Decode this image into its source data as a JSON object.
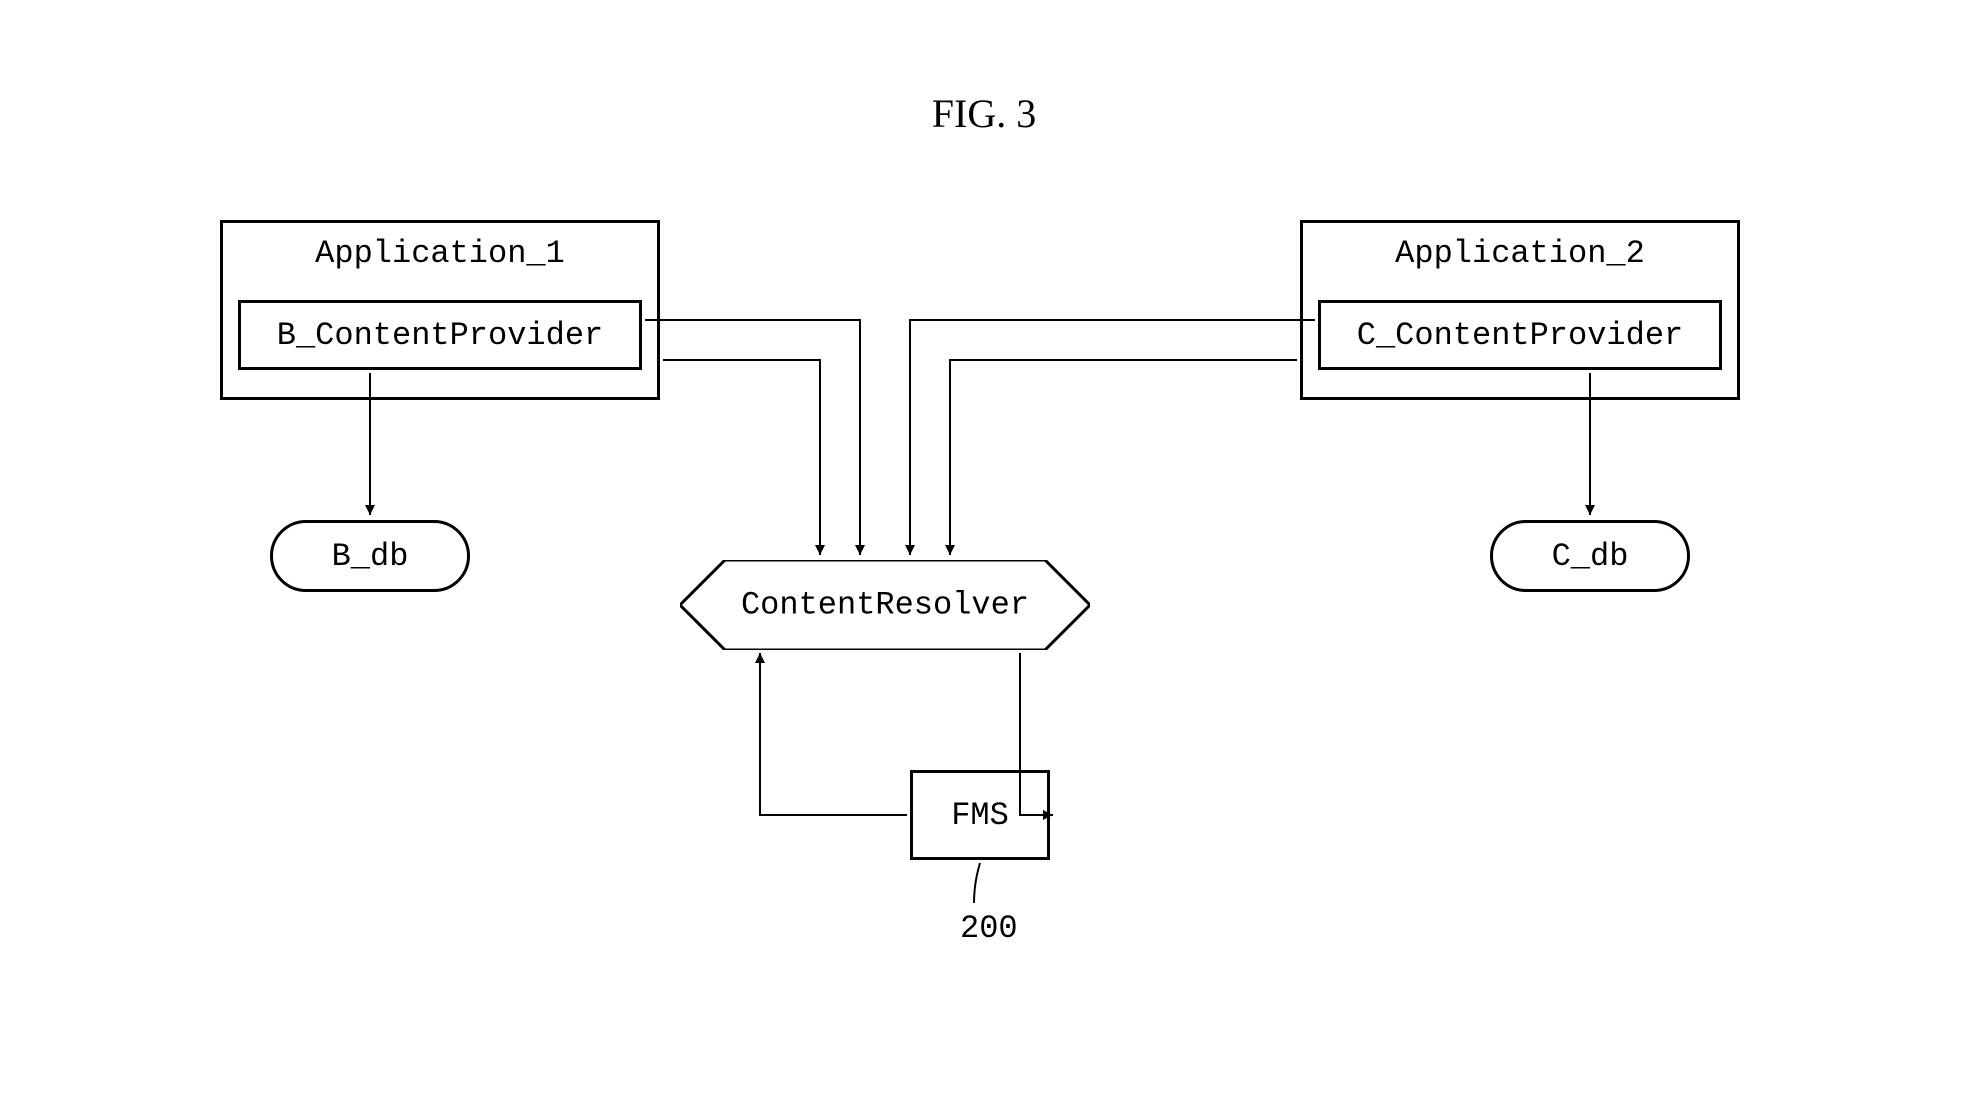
{
  "figure_title": "FIG. 3",
  "app1": {
    "title": "Application_1",
    "provider": "B_ContentProvider",
    "db": "B_db"
  },
  "app2": {
    "title": "Application_2",
    "provider": "C_ContentProvider",
    "db": "C_db"
  },
  "resolver": "ContentResolver",
  "fms": {
    "label": "FMS",
    "ref": "200"
  }
}
